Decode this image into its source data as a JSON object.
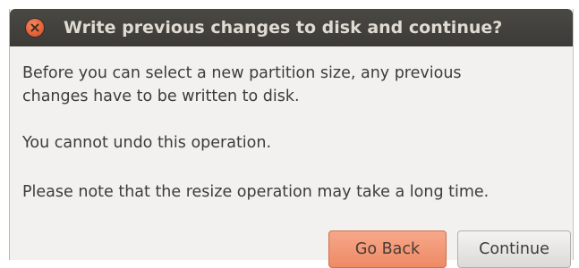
{
  "window": {
    "title": "Write previous changes to disk and continue?",
    "close_icon": "close-icon",
    "close_color": "#e8643a"
  },
  "message": {
    "line1": "Before you can select a new partition size, any previous",
    "line2": "changes have to be written to disk.",
    "warning": "You cannot undo this operation.",
    "note": "Please note that the resize operation may take a long time."
  },
  "buttons": {
    "go_back": "Go Back",
    "continue": "Continue",
    "accent_color": "#ee8a65"
  }
}
